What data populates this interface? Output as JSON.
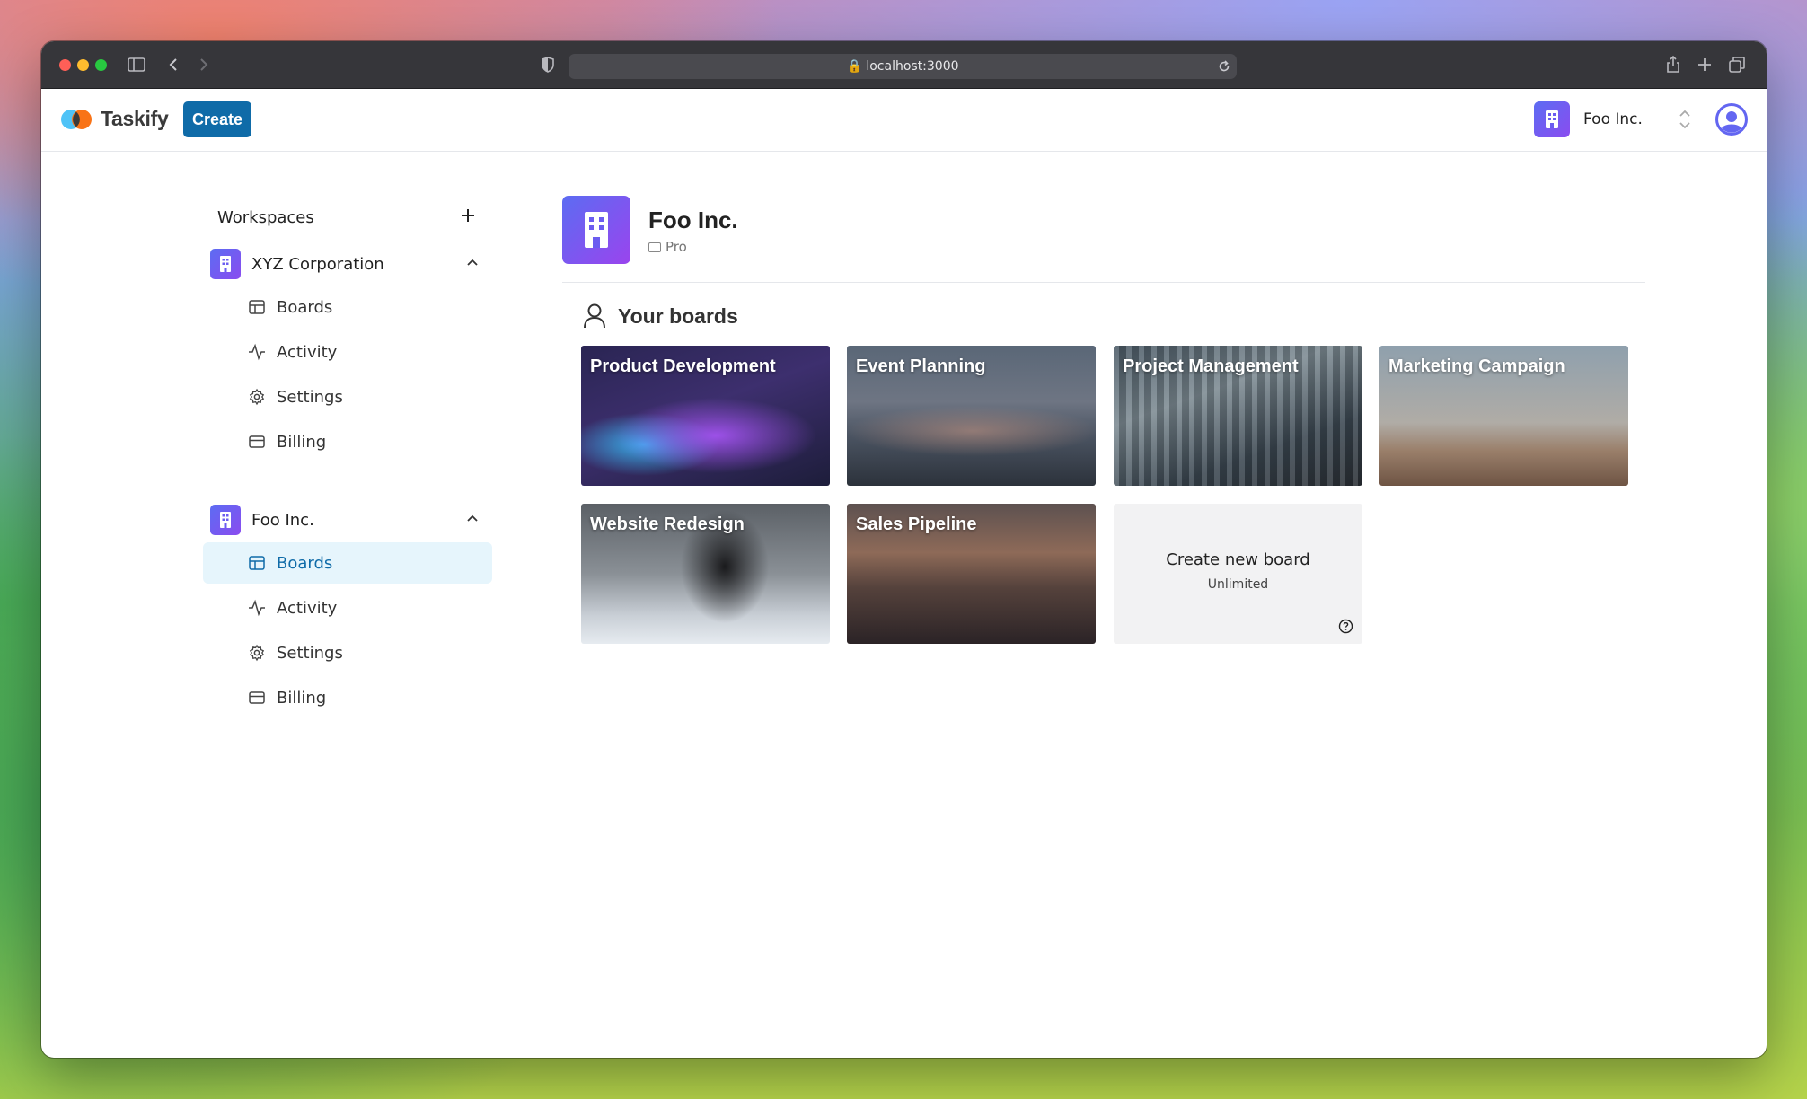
{
  "browser": {
    "url": "localhost:3000"
  },
  "header": {
    "app_name": "Taskify",
    "create_label": "Create",
    "current_workspace": "Foo Inc."
  },
  "sidebar": {
    "heading": "Workspaces",
    "organizations": [
      {
        "name": "XYZ Corporation",
        "expanded": true,
        "items": [
          {
            "label": "Boards",
            "icon": "layout-icon",
            "active": false
          },
          {
            "label": "Activity",
            "icon": "activity-icon",
            "active": false
          },
          {
            "label": "Settings",
            "icon": "gear-icon",
            "active": false
          },
          {
            "label": "Billing",
            "icon": "credit-card-icon",
            "active": false
          }
        ]
      },
      {
        "name": "Foo Inc.",
        "expanded": true,
        "items": [
          {
            "label": "Boards",
            "icon": "layout-icon",
            "active": true
          },
          {
            "label": "Activity",
            "icon": "activity-icon",
            "active": false
          },
          {
            "label": "Settings",
            "icon": "gear-icon",
            "active": false
          },
          {
            "label": "Billing",
            "icon": "credit-card-icon",
            "active": false
          }
        ]
      }
    ]
  },
  "main": {
    "org_name": "Foo Inc.",
    "plan": "Pro",
    "boards_heading": "Your boards",
    "boards": [
      {
        "title": "Product Development"
      },
      {
        "title": "Event Planning"
      },
      {
        "title": "Project Management"
      },
      {
        "title": "Marketing Campaign"
      },
      {
        "title": "Website Redesign"
      },
      {
        "title": "Sales Pipeline"
      }
    ],
    "create_board": {
      "title": "Create new board",
      "subtitle": "Unlimited"
    }
  },
  "colors": {
    "accent": "#0f6ba8",
    "active_bg": "#e6f5fc",
    "workspace_gradient_start": "#5c6cf2",
    "workspace_gradient_end": "#8a4cf0"
  }
}
